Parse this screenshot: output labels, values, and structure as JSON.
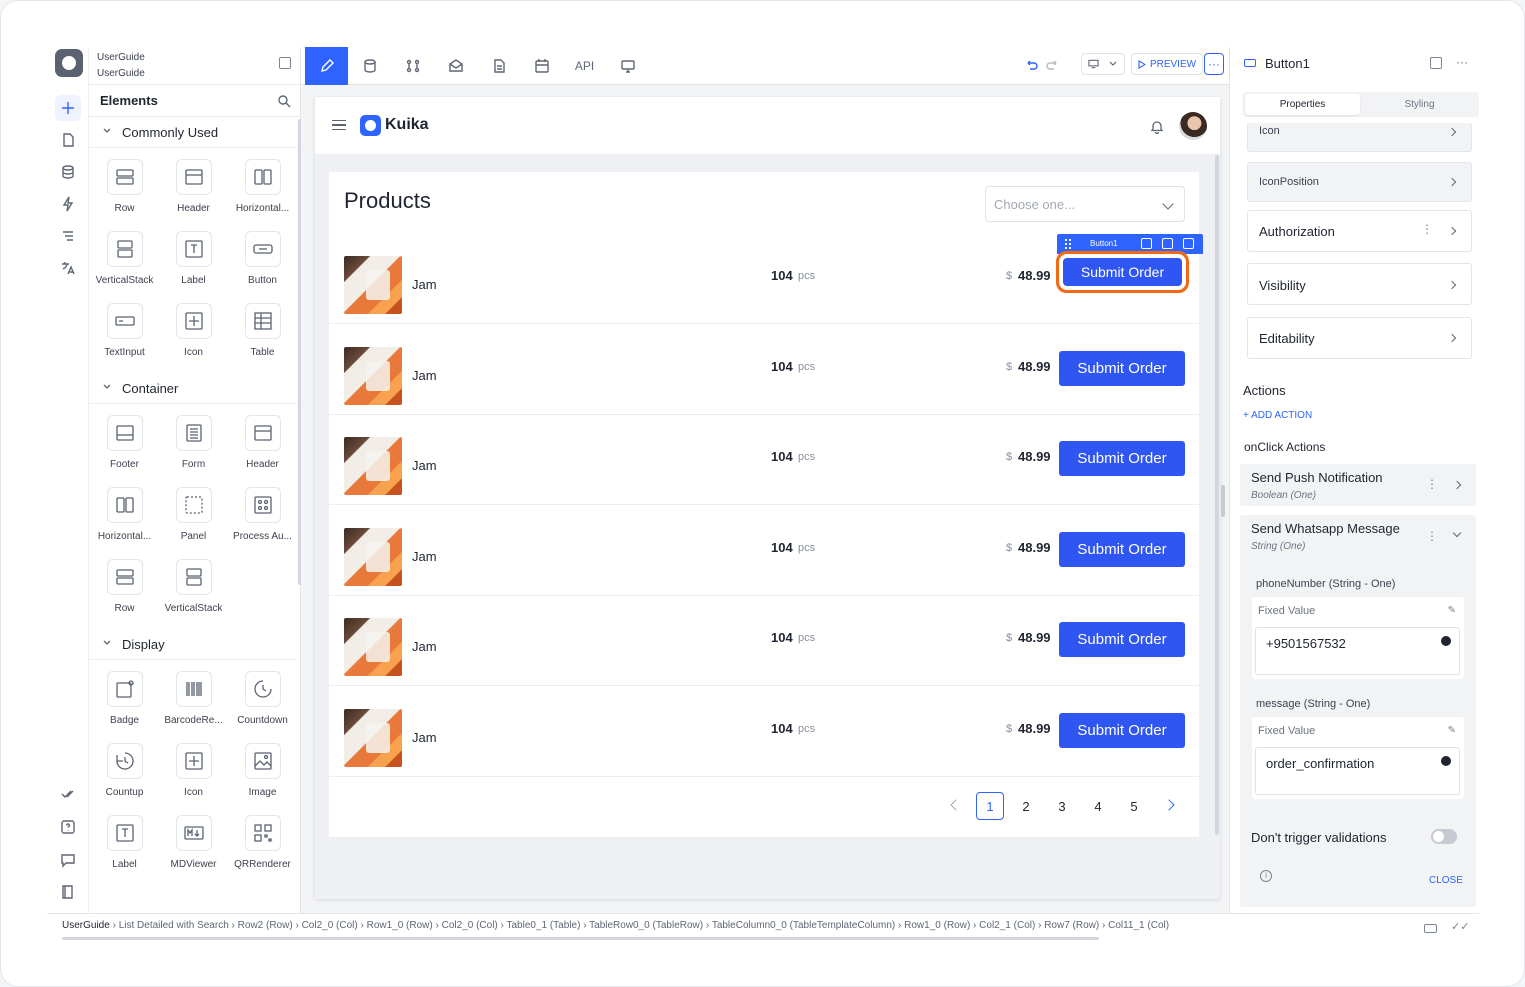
{
  "project": {
    "line1": "UserGuide",
    "line2": "UserGuide"
  },
  "toolbar": {
    "api_label": "API",
    "preview_label": "PREVIEW",
    "more_label": "···"
  },
  "elements_panel": {
    "title": "Elements",
    "sections": [
      {
        "label": "Commonly Used",
        "items": [
          "Row",
          "Header",
          "Horizontal...",
          "VerticalStack",
          "Label",
          "Button",
          "TextInput",
          "Icon",
          "Table"
        ]
      },
      {
        "label": "Container",
        "items": [
          "Footer",
          "Form",
          "Header",
          "Horizontal...",
          "Panel",
          "Process Au...",
          "Row",
          "VerticalStack"
        ]
      },
      {
        "label": "Display",
        "items": [
          "Badge",
          "BarcodeRe...",
          "Countdown",
          "Countup",
          "Icon",
          "Image",
          "Label",
          "MDViewer",
          "QRRenderer"
        ]
      }
    ]
  },
  "app": {
    "brand": "Kuika",
    "card_title": "Products",
    "select_placeholder": "Choose one...",
    "selected_component": "Button1",
    "rows": [
      {
        "name": "Jam",
        "qty": "104",
        "unit": "pcs",
        "currency": "$",
        "price": "48.99",
        "button": "Submit Order"
      },
      {
        "name": "Jam",
        "qty": "104",
        "unit": "pcs",
        "currency": "$",
        "price": "48.99",
        "button": "Submit Order"
      },
      {
        "name": "Jam",
        "qty": "104",
        "unit": "pcs",
        "currency": "$",
        "price": "48.99",
        "button": "Submit Order"
      },
      {
        "name": "Jam",
        "qty": "104",
        "unit": "pcs",
        "currency": "$",
        "price": "48.99",
        "button": "Submit Order"
      },
      {
        "name": "Jam",
        "qty": "104",
        "unit": "pcs",
        "currency": "$",
        "price": "48.99",
        "button": "Submit Order"
      },
      {
        "name": "Jam",
        "qty": "104",
        "unit": "pcs",
        "currency": "$",
        "price": "48.99",
        "button": "Submit Order"
      }
    ],
    "pages": [
      "1",
      "2",
      "3",
      "4",
      "5"
    ],
    "active_page": "1"
  },
  "properties": {
    "component": "Button1",
    "tabs": [
      "Properties",
      "Styling"
    ],
    "icon_row": "Icon",
    "icon_position": "IconPosition",
    "authorization": "Authorization",
    "visibility": "Visibility",
    "editability": "Editability",
    "actions_title": "Actions",
    "add_action": "+ ADD ACTION",
    "onclick_title": "onClick Actions",
    "action1": {
      "name": "Send Push Notification",
      "type": "Boolean (One)"
    },
    "action2": {
      "name": "Send Whatsapp Message",
      "type": "String (One)"
    },
    "param1": {
      "label": "phoneNumber (String - One)",
      "mode": "Fixed Value",
      "value": "+9501567532"
    },
    "param2": {
      "label": "message (String - One)",
      "mode": "Fixed Value",
      "value": "order_confirmation"
    },
    "validation_label": "Don't trigger validations",
    "close_label": "CLOSE"
  },
  "breadcrumb": {
    "root": "UserGuide",
    "items": [
      "List Detailed with Search",
      "Row2 (Row)",
      "Col2_0 (Col)",
      "Row1_0 (Row)",
      "Col2_0 (Col)",
      "Table0_1 (Table)",
      "TableRow0_0 (TableRow)",
      "TableColumn0_0 (TableTemplateColumn)",
      "Row1_0 (Row)",
      "Col2_1 (Col)",
      "Row7 (Row)",
      "Col11_1 (Col)"
    ]
  },
  "colors": {
    "accent": "#2f63ff",
    "button": "#2f55f2",
    "highlight": "#f36a14"
  }
}
